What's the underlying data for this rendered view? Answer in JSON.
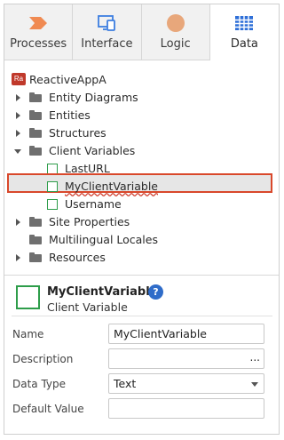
{
  "tabs": [
    {
      "label": "Processes",
      "icon": "process-chevron-icon",
      "color": "#f08a52"
    },
    {
      "label": "Interface",
      "icon": "monitor-icon",
      "color": "#3d7ee0"
    },
    {
      "label": "Logic",
      "icon": "circle-icon",
      "color": "#e8a77b"
    },
    {
      "label": "Data",
      "icon": "table-grid-icon",
      "color": "#2e6fd8"
    }
  ],
  "active_tab": "Data",
  "tree": {
    "root": {
      "badge": "Ra",
      "label": "ReactiveAppA"
    },
    "entity_diagrams": "Entity Diagrams",
    "entities": "Entities",
    "structures": "Structures",
    "client_variables": "Client Variables",
    "last_url": "LastURL",
    "my_client_variable": "MyClientVariable",
    "username": "Username",
    "site_properties": "Site Properties",
    "multilingual_locales": "Multilingual Locales",
    "resources": "Resources"
  },
  "details": {
    "title": "MyClientVariable",
    "subtitle": "Client Variable",
    "help": "?"
  },
  "properties": {
    "name_label": "Name",
    "name_value": "MyClientVariable",
    "description_label": "Description",
    "description_value": "",
    "description_button": "...",
    "data_type_label": "Data Type",
    "data_type_value": "Text",
    "default_value_label": "Default Value",
    "default_value_value": ""
  },
  "colors": {
    "accent_green": "#2e9d4a",
    "selection_border": "#d9482b",
    "help_blue": "#2f6cc9"
  }
}
